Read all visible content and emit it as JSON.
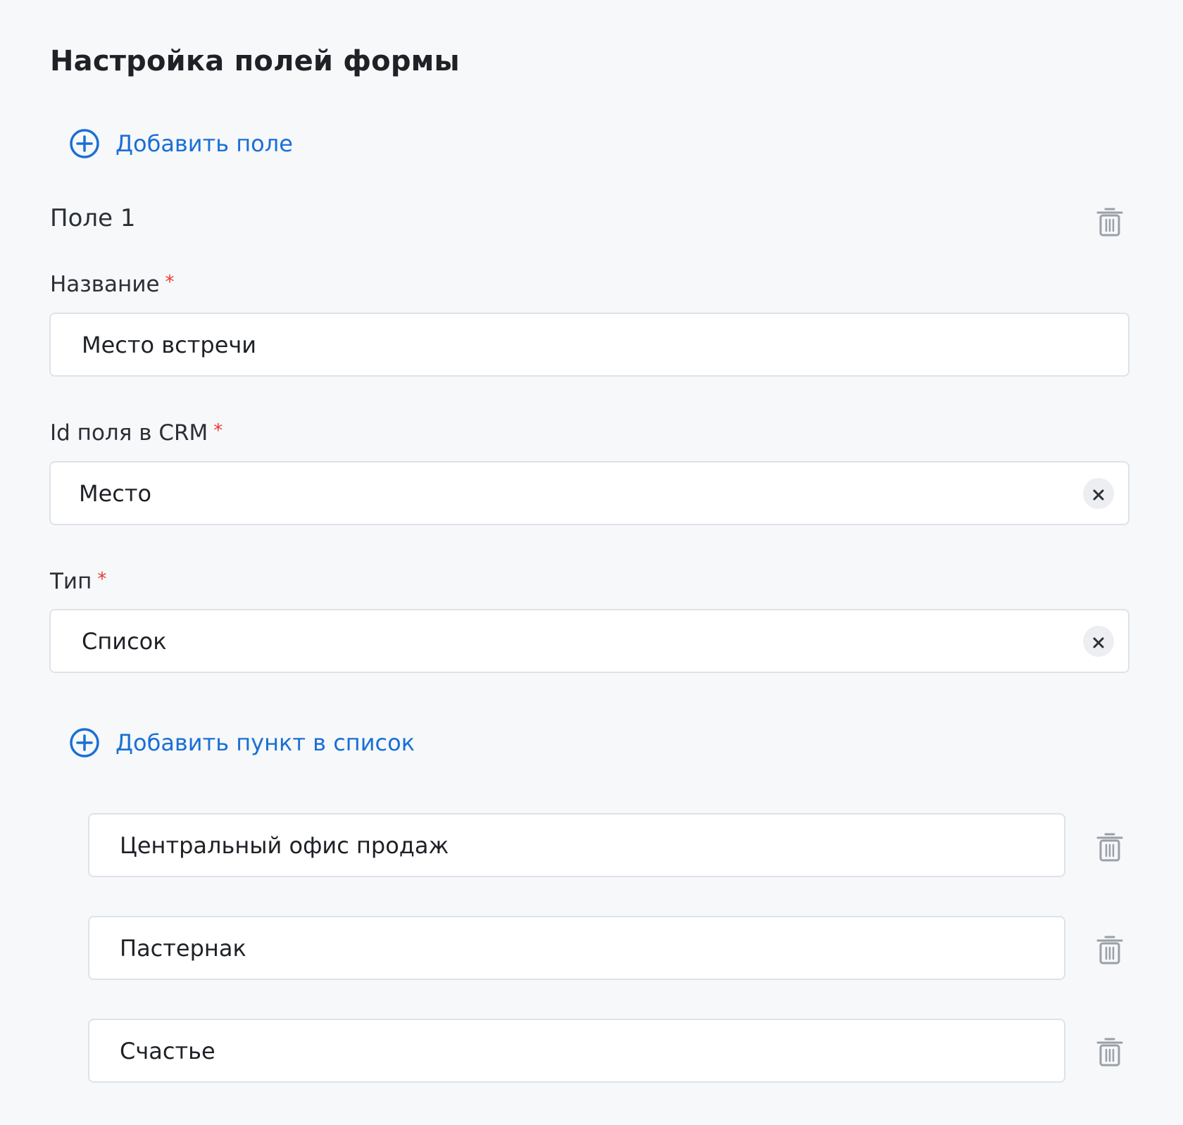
{
  "page": {
    "title": "Настройка полей формы",
    "add_field_label": "Добавить поле"
  },
  "field": {
    "header": "Поле 1",
    "required_mark": "*",
    "name": {
      "label": "Название",
      "value": "Место встречи"
    },
    "crm_id": {
      "label": "Id поля в CRM",
      "value": "Место"
    },
    "type": {
      "label": "Тип",
      "value": "Список"
    },
    "add_item_label": "Добавить пункт в список",
    "items": [
      {
        "value": "Центральный офис продаж"
      },
      {
        "value": "Пастернак"
      },
      {
        "value": "Счастье"
      }
    ]
  },
  "colors": {
    "accent": "#1a6fd6",
    "required": "#e53935",
    "background": "#f6f8fa",
    "border": "#dfe3e8",
    "icon_gray": "#9aa0a8"
  },
  "icons": {
    "add": "plus-circle-icon",
    "delete": "trash-icon",
    "clear": "close-icon"
  }
}
